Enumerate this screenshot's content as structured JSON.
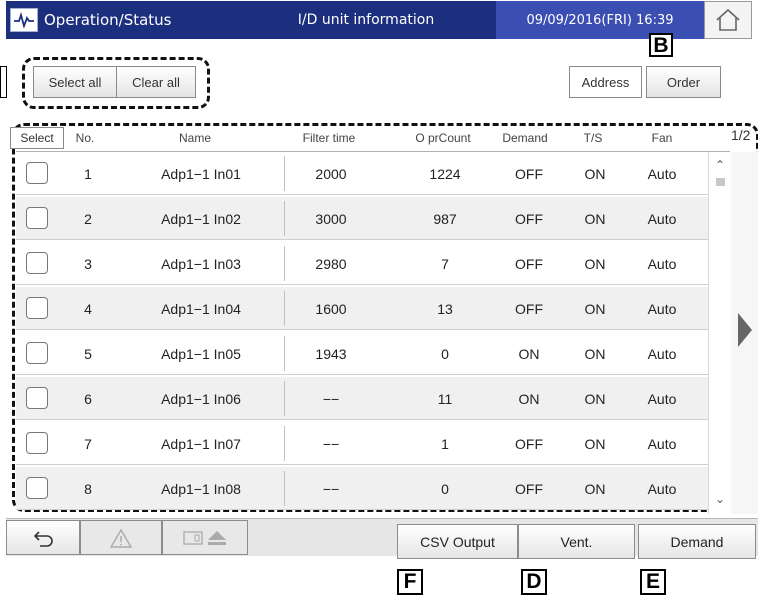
{
  "header": {
    "title": "Operation/Status",
    "info": "I/D unit information",
    "datetime": "09/09/2016(FRI) 16:39"
  },
  "toolbar": {
    "select_all": "Select all",
    "clear_all": "Clear all",
    "address": "Address",
    "order": "Order"
  },
  "table": {
    "columns": {
      "select": "Select",
      "no": "No.",
      "name": "Name",
      "filter_time": "Filter time",
      "opr_count": "O prCount",
      "demand": "Demand",
      "ts": "T/S",
      "fan": "Fan"
    },
    "page": "1/2",
    "rows": [
      {
        "no": "1",
        "name": "Adp1−1 In01",
        "filter": "2000",
        "count": "1224",
        "demand": "OFF",
        "ts": "ON",
        "fan": "Auto"
      },
      {
        "no": "2",
        "name": "Adp1−1 In02",
        "filter": "3000",
        "count": "987",
        "demand": "OFF",
        "ts": "ON",
        "fan": "Auto"
      },
      {
        "no": "3",
        "name": "Adp1−1 In03",
        "filter": "2980",
        "count": "7",
        "demand": "OFF",
        "ts": "ON",
        "fan": "Auto"
      },
      {
        "no": "4",
        "name": "Adp1−1 In04",
        "filter": "1600",
        "count": "13",
        "demand": "OFF",
        "ts": "ON",
        "fan": "Auto"
      },
      {
        "no": "5",
        "name": "Adp1−1 In05",
        "filter": "1943",
        "count": "0",
        "demand": "ON",
        "ts": "ON",
        "fan": "Auto"
      },
      {
        "no": "6",
        "name": "Adp1−1 In06",
        "filter": "−−",
        "count": "11",
        "demand": "ON",
        "ts": "ON",
        "fan": "Auto"
      },
      {
        "no": "7",
        "name": "Adp1−1 In07",
        "filter": "−−",
        "count": "1",
        "demand": "OFF",
        "ts": "ON",
        "fan": "Auto"
      },
      {
        "no": "8",
        "name": "Adp1−1 In08",
        "filter": "−−",
        "count": "0",
        "demand": "OFF",
        "ts": "ON",
        "fan": "Auto"
      }
    ]
  },
  "footer": {
    "csv_output": "CSV Output",
    "vent": "Vent.",
    "demand": "Demand"
  },
  "markers": {
    "b": "B",
    "f": "F",
    "d": "D",
    "e": "E"
  },
  "colors": {
    "header_dark": "#1c2f7e",
    "header_light": "#3b4fb2",
    "row_alt": "#f0f0f0"
  }
}
